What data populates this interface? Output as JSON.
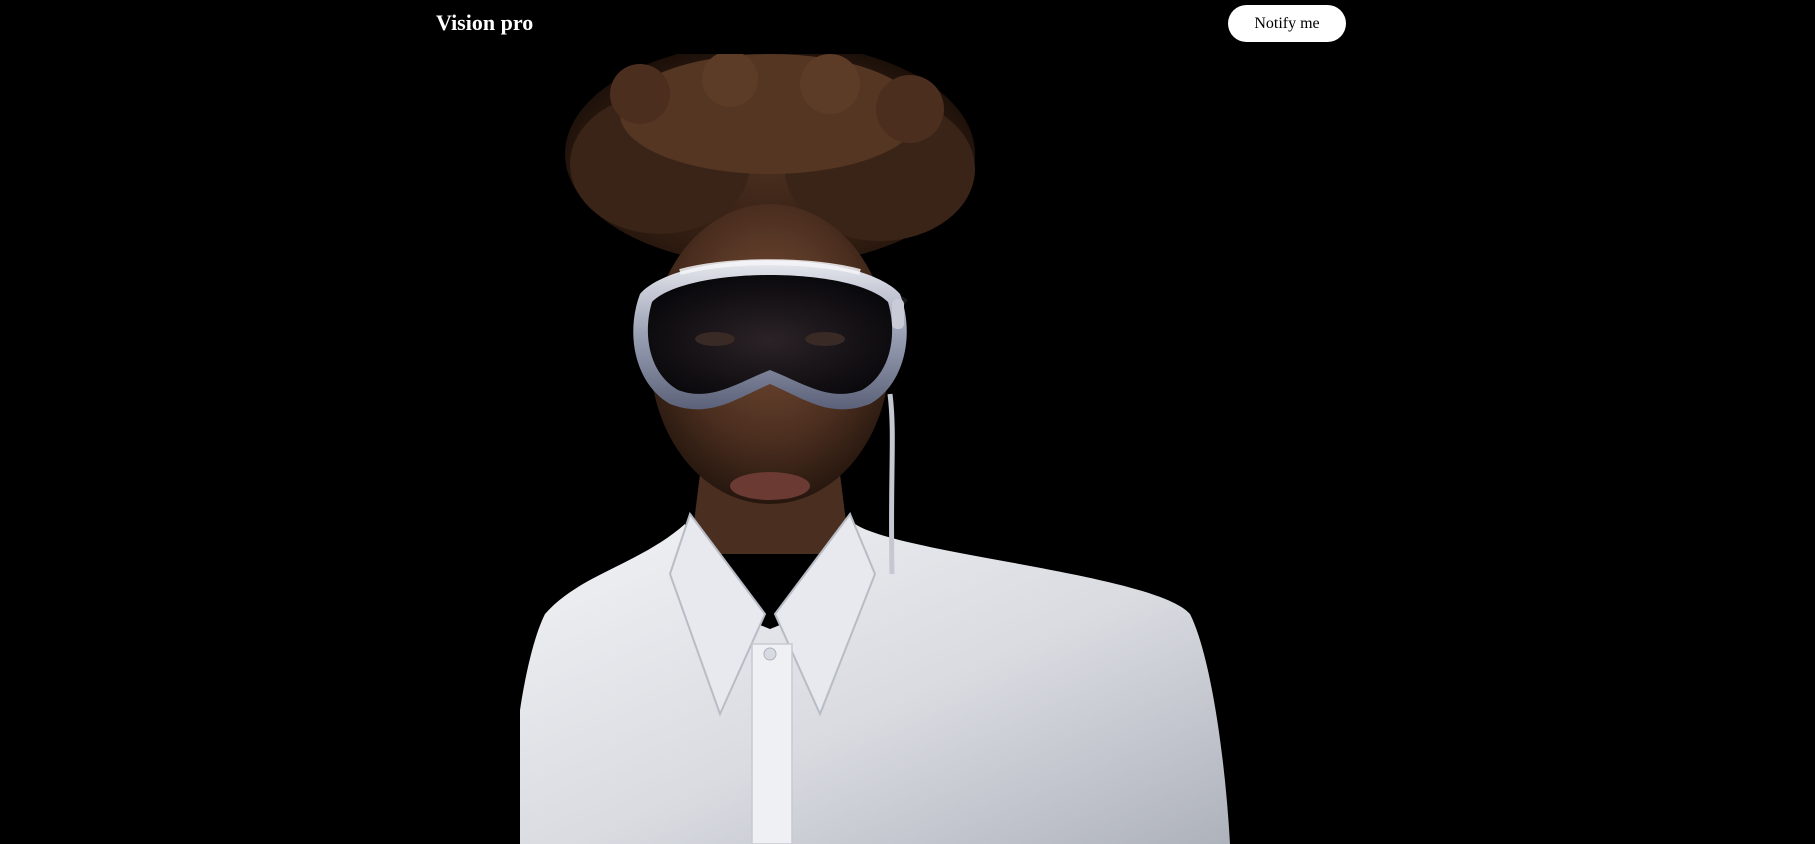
{
  "header": {
    "brand": "Vision pro",
    "notify_label": "Notify me"
  },
  "hero": {
    "image_subject": "person-wearing-headset"
  },
  "colors": {
    "background": "#000000",
    "brand_text": "#ffffff",
    "button_bg": "#ffffff",
    "button_text": "#000000"
  }
}
